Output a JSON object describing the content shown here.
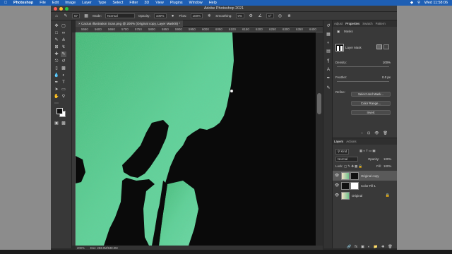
{
  "menubar": {
    "items": [
      "Photoshop",
      "File",
      "Edit",
      "Image",
      "Layer",
      "Type",
      "Select",
      "Filter",
      "3D",
      "View",
      "Plugins",
      "Window",
      "Help"
    ],
    "clock": "Wed 11:58:06"
  },
  "window": {
    "title": "Adobe Photoshop 2021"
  },
  "options": {
    "mode_label": "Mode:",
    "mode_value": "Normal",
    "opacity_label": "Opacity:",
    "opacity_value": "100%",
    "flow_label": "Flow:",
    "flow_value": "100%",
    "smoothing_label": "Smoothing:",
    "smoothing_value": "0%",
    "angle_value": "0°",
    "brush_size": "57"
  },
  "document": {
    "tab_title": "Cactus Illustration Scan.png @ 200% (Original copy, Layer Mask/8) *",
    "ruler_ticks": [
      "5550",
      "5600",
      "5650",
      "5700",
      "5750",
      "5800",
      "5850",
      "5900",
      "5950",
      "6000",
      "6050",
      "6100",
      "6150",
      "6200",
      "6250",
      "6300",
      "6350",
      "6400"
    ],
    "zoom": "200%",
    "doc_info": "Doc: 283.0M/848.0M"
  },
  "properties": {
    "tabs": [
      "Adjust",
      "Properties",
      "Swatch",
      "Pattern"
    ],
    "section": "Masks",
    "mask_label": "Layer Mask",
    "density_label": "Density:",
    "density_value": "100%",
    "feather_label": "Feather:",
    "feather_value": "0.0 px",
    "refine_label": "Refine:",
    "select_mask_btn": "Select and Mask...",
    "color_range_btn": "Color Range...",
    "invert_btn": "Invert"
  },
  "layers": {
    "tabs": [
      "Layers",
      "Actions"
    ],
    "filter_kind": "Kind",
    "blend_mode": "Normal",
    "opacity_label": "Opacity:",
    "opacity_value": "100%",
    "lock_label": "Lock:",
    "fill_label": "Fill:",
    "fill_value": "100%",
    "items": [
      {
        "name": "Original copy",
        "selected": true
      },
      {
        "name": "Color Fill 1",
        "selected": false
      },
      {
        "name": "Original",
        "selected": false
      }
    ]
  },
  "colors": {
    "mask_green": "#52c98a",
    "menubar_blue": "#1e5fb4",
    "fg": "#111111",
    "bg": "#ffffff"
  }
}
